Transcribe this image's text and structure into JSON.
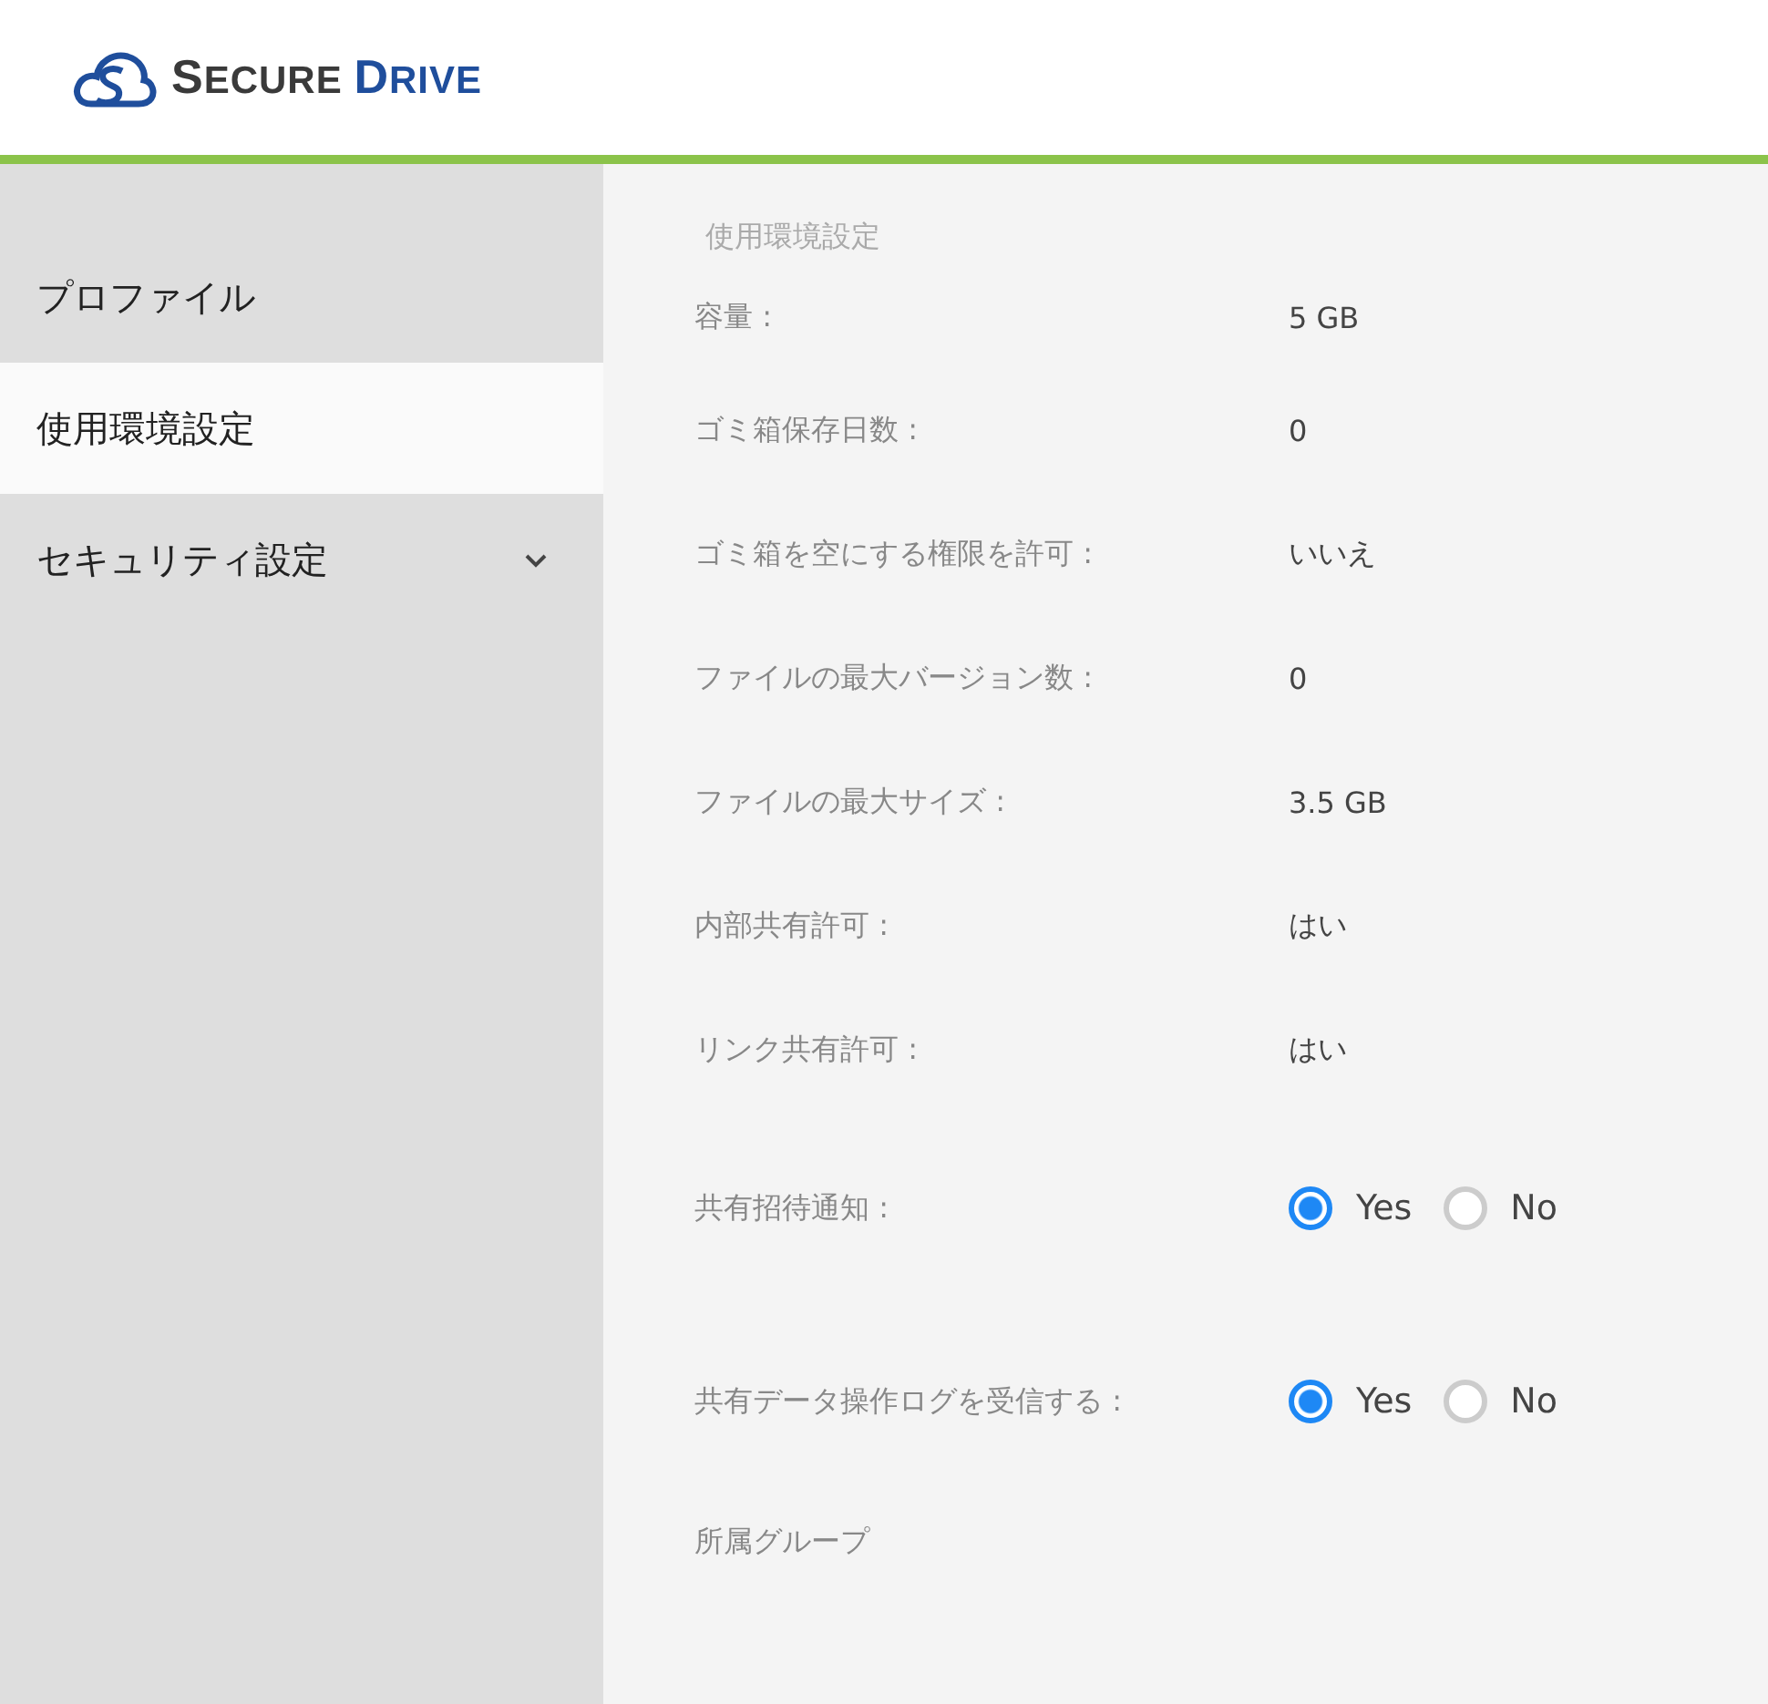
{
  "logo": {
    "words": [
      "SECURE",
      "DRIVE"
    ]
  },
  "sidebar": {
    "items": [
      {
        "label": "プロファイル",
        "selected": false,
        "expandable": false
      },
      {
        "label": "使用環境設定",
        "selected": true,
        "expandable": false
      },
      {
        "label": "セキュリティ設定",
        "selected": false,
        "expandable": true
      }
    ]
  },
  "content": {
    "title": "使用環境設定",
    "rows": [
      {
        "kind": "text",
        "label": "容量 :",
        "value": "5 GB"
      },
      {
        "kind": "text",
        "label": "ゴミ箱保存日数 :",
        "value": "0"
      },
      {
        "kind": "text",
        "label": "ゴミ箱を空にする権限を許可 :",
        "value": "いいえ"
      },
      {
        "kind": "text",
        "label": "ファイルの最大バージョン数 :",
        "value": "0"
      },
      {
        "kind": "text",
        "label": "ファイルの最大サイズ :",
        "value": "3.5 GB"
      },
      {
        "kind": "text",
        "label": "内部共有許可 :",
        "value": "はい"
      },
      {
        "kind": "text",
        "label": "リンク共有許可 :",
        "value": "はい"
      },
      {
        "kind": "radio",
        "label": "共有招待通知 :",
        "options": [
          {
            "label": "Yes",
            "selected": true
          },
          {
            "label": "No",
            "selected": false
          }
        ]
      },
      {
        "kind": "radio",
        "label": "共有データ操作ログを受信する :",
        "options": [
          {
            "label": "Yes",
            "selected": true
          },
          {
            "label": "No",
            "selected": false
          }
        ]
      }
    ],
    "section": "所属グループ"
  }
}
